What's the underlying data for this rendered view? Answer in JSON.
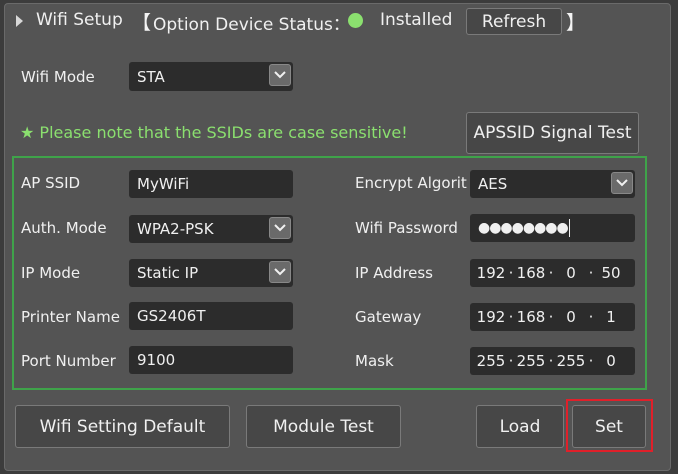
{
  "header": {
    "title": "Wifi Setup",
    "bracket_open": "【",
    "status_label": "Option Device Status：",
    "status_color": "#8be06f",
    "status_value": "Installed",
    "refresh_label": "Refresh",
    "bracket_close": "】"
  },
  "wifi_mode": {
    "label": "Wifi Mode",
    "value": "STA"
  },
  "note": "★ Please note that the SSIDs are case sensitive!",
  "apssid_test_label": "APSSID Signal Test",
  "form": {
    "ap_ssid": {
      "label": "AP SSID",
      "value": "MyWiFi"
    },
    "auth_mode": {
      "label": "Auth. Mode",
      "value": "WPA2-PSK"
    },
    "ip_mode": {
      "label": "IP Mode",
      "value": "Static IP"
    },
    "printer_name": {
      "label": "Printer Name",
      "value": "GS2406T"
    },
    "port_number": {
      "label": "Port Number",
      "value": "9100"
    },
    "encrypt": {
      "label": "Encrypt Algorit",
      "value": "AES"
    },
    "password": {
      "label": "Wifi Password",
      "value": "●●●●●●●●"
    },
    "ip_address": {
      "label": "IP Address",
      "octets": [
        "192",
        "168",
        "0",
        "50"
      ]
    },
    "gateway": {
      "label": "Gateway",
      "octets": [
        "192",
        "168",
        "0",
        "1"
      ]
    },
    "mask": {
      "label": "Mask",
      "octets": [
        "255",
        "255",
        "255",
        "0"
      ]
    },
    "separator": "·"
  },
  "buttons": {
    "default": "Wifi Setting Default",
    "module_test": "Module Test",
    "load": "Load",
    "set": "Set"
  },
  "colors": {
    "highlight": "#e0202a",
    "group_border": "#3fa34a"
  }
}
